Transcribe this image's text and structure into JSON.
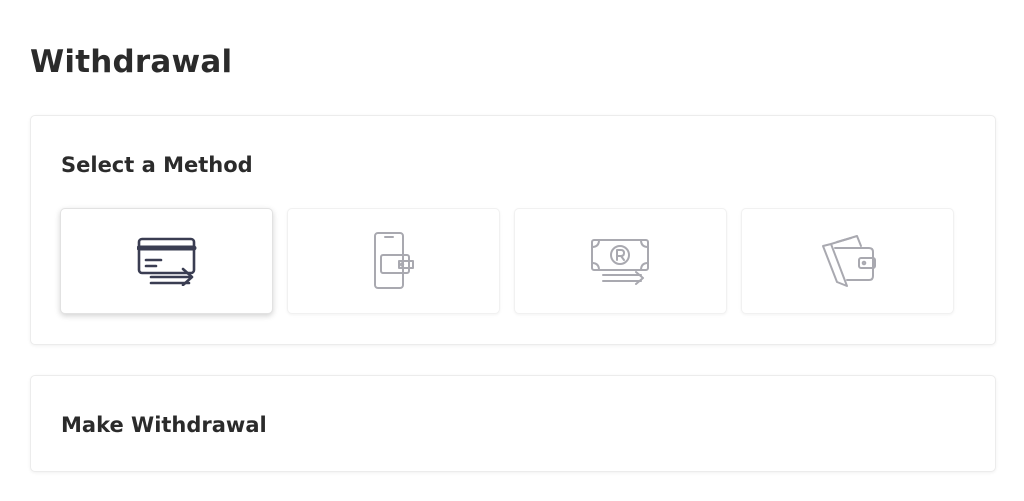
{
  "page": {
    "title": "Withdrawal"
  },
  "method_section": {
    "title": "Select a Method",
    "options": [
      {
        "icon": "card-transfer-icon",
        "selected": true
      },
      {
        "icon": "mobile-wallet-icon",
        "selected": false
      },
      {
        "icon": "cash-transfer-icon",
        "selected": false
      },
      {
        "icon": "wallet-icon",
        "selected": false
      }
    ]
  },
  "withdraw_section": {
    "title": "Make Withdrawal"
  },
  "colors": {
    "selected_icon": "#3a3d52",
    "inactive_icon": "#a9a9b0",
    "title_text": "#2b2b2b",
    "border": "#ececec"
  }
}
